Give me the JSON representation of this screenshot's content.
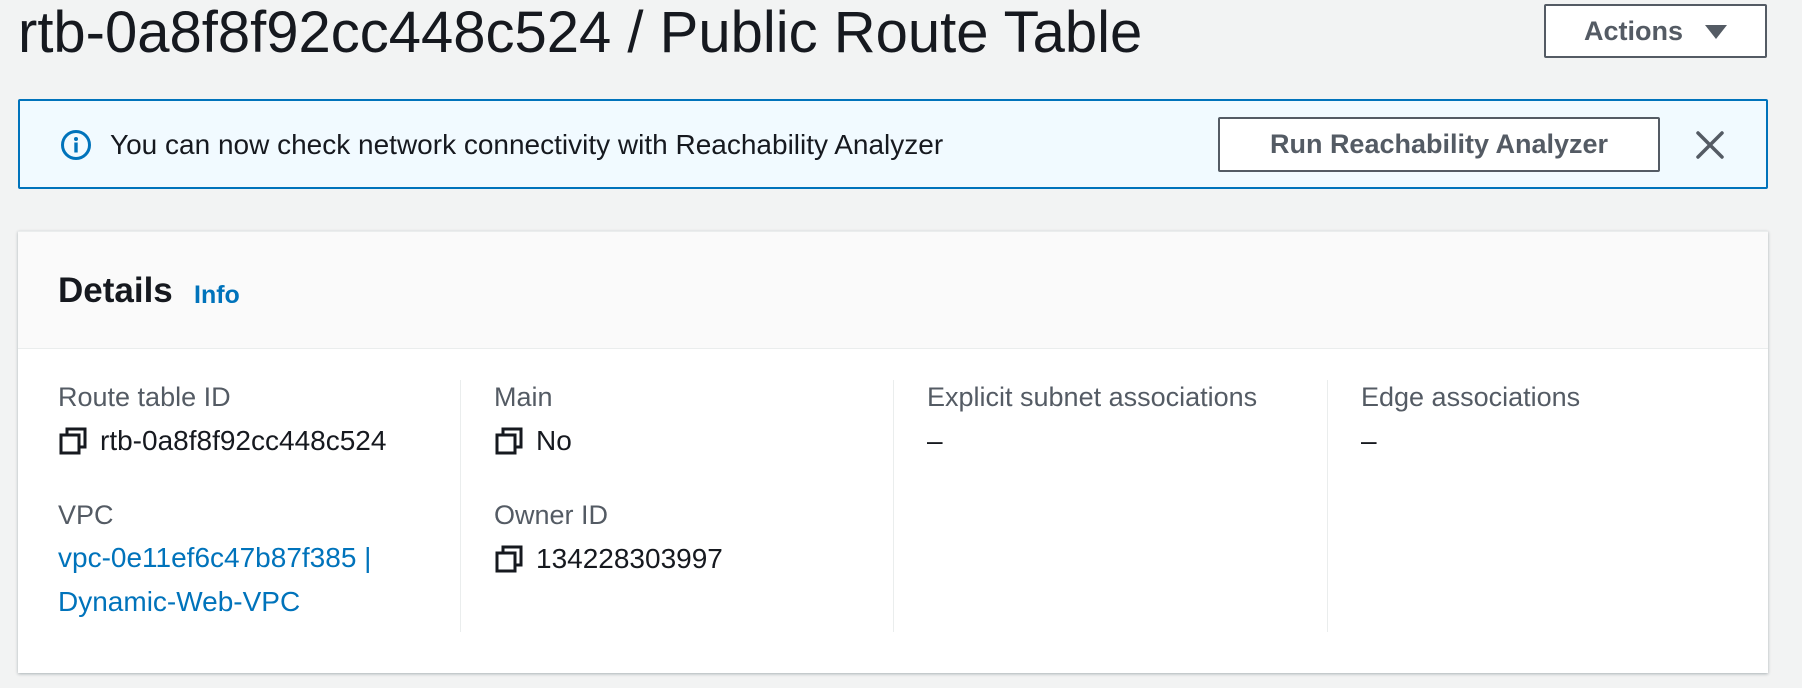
{
  "header": {
    "title": "rtb-0a8f8f92cc448c524 / Public Route Table",
    "actions_label": "Actions"
  },
  "banner": {
    "icon": "info-icon",
    "message": "You can now check network connectivity with Reachability Analyzer",
    "button_label": "Run Reachability Analyzer",
    "close_icon": "close-icon"
  },
  "details": {
    "title": "Details",
    "info_label": "Info",
    "route_table_id": {
      "label": "Route table ID",
      "value": "rtb-0a8f8f92cc448c524"
    },
    "vpc": {
      "label": "VPC",
      "line1": "vpc-0e11ef6c47b87f385 |",
      "line2": "Dynamic-Web-VPC"
    },
    "main": {
      "label": "Main",
      "value": "No"
    },
    "owner_id": {
      "label": "Owner ID",
      "value": "134228303997"
    },
    "explicit_subnet": {
      "label": "Explicit subnet associations",
      "value": "–"
    },
    "edge": {
      "label": "Edge associations",
      "value": "–"
    }
  },
  "colors": {
    "accent": "#0073bb",
    "page_bg": "#f2f3f3",
    "banner_bg": "#f1faff",
    "text": "#16191f",
    "muted": "#545b64"
  }
}
